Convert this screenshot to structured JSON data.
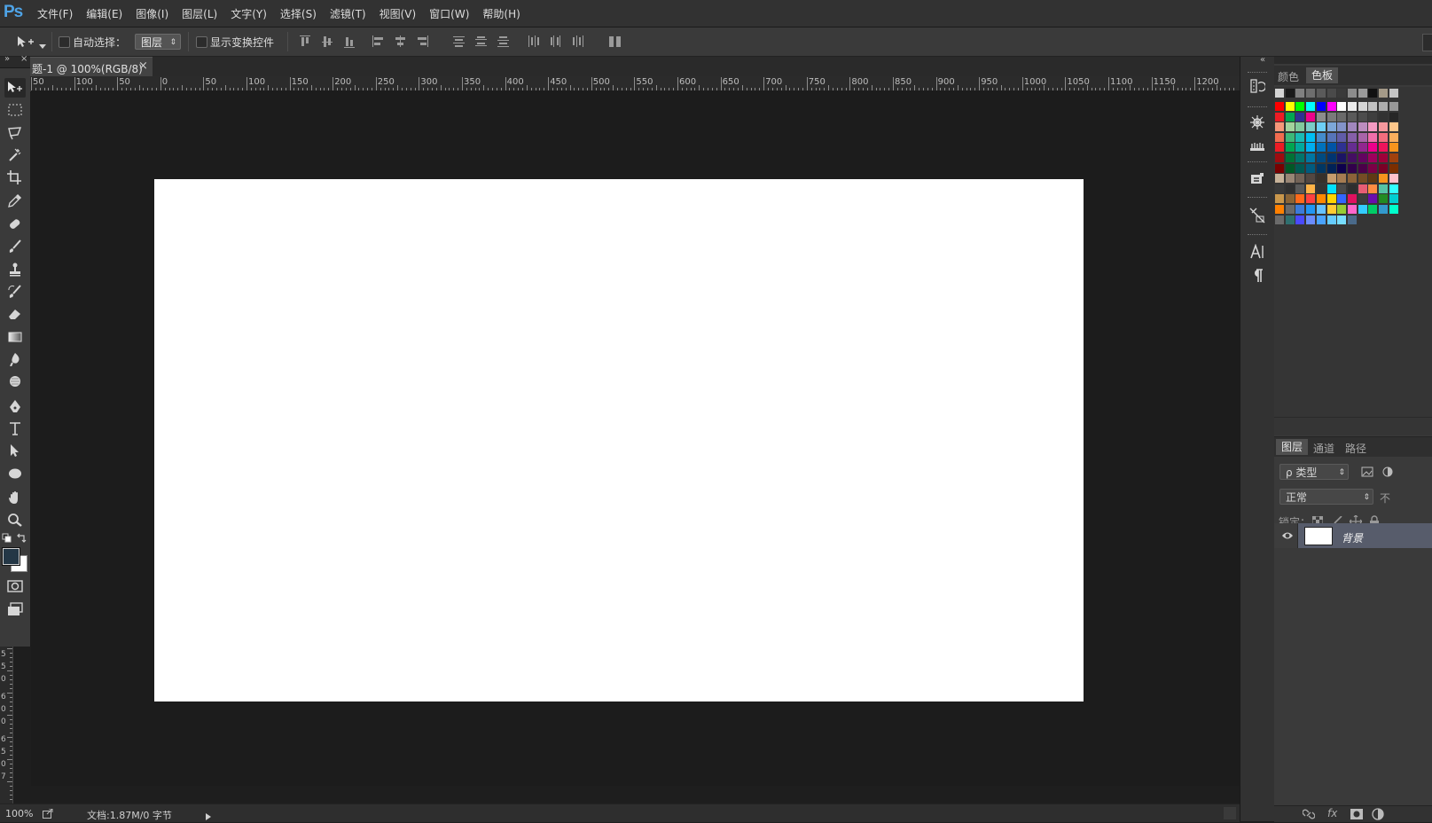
{
  "app": {
    "logo": "Ps"
  },
  "menu": [
    "文件(F)",
    "编辑(E)",
    "图像(I)",
    "图层(L)",
    "文字(Y)",
    "选择(S)",
    "滤镜(T)",
    "视图(V)",
    "窗口(W)",
    "帮助(H)"
  ],
  "options": {
    "auto_select_label": "自动选择：",
    "auto_select_value": "图层",
    "show_transform_label": "显示变换控件"
  },
  "document_tab": {
    "title": "题-1 @ 100%(RGB/8)",
    "close": "×"
  },
  "ruler": {
    "h_labels": [
      "50",
      "100",
      "50",
      "0",
      "50",
      "100",
      "150",
      "200",
      "250",
      "300",
      "350",
      "400",
      "450",
      "500",
      "550",
      "600",
      "650",
      "700",
      "750",
      "800",
      "850",
      "900",
      "950",
      "1000",
      "1050",
      "1100",
      "1150",
      "1200"
    ],
    "v_labels": [
      "5",
      "5",
      "0",
      "6",
      "0",
      "0",
      "6",
      "5",
      "0",
      "7"
    ]
  },
  "right_panel": {
    "top_tabs": [
      "颜色",
      "色板"
    ],
    "active_top_tab": "色板",
    "layer_tabs": [
      "图层",
      "通道",
      "路径"
    ],
    "kind_filter": "ρ 类型",
    "blend_mode": "正常",
    "opacity_label": "不",
    "lock_label": "锁定：",
    "layer_name": "背景"
  },
  "status": {
    "zoom": "100%",
    "doc_info": "文档:1.87M/0 字节"
  },
  "colors": {
    "menubar_bg": "#323232",
    "panel_bg": "#3a3a3a",
    "workspace_bg": "#1c1c1c",
    "canvas": "#ffffff",
    "selected_layer": "#575c6b"
  },
  "swatch_rows": [
    [
      "#d4d4d4",
      "#1a1a1a",
      "#808080",
      "#6e6e6e",
      "#5a5a5a",
      "#4a4a4a",
      "#3a3a3a",
      "#8c8c8c",
      "#9a9a9a",
      "#111111",
      "#a49a88",
      "#c4c4c4"
    ],
    [
      "#ff0000",
      "#ffff00",
      "#00ff00",
      "#00ffff",
      "#0000ff",
      "#ff00ff",
      "#ffffff",
      "#ebebeb",
      "#d6d6d6",
      "#c2c2c2",
      "#adadad",
      "#999999"
    ],
    [
      "#ed1c24",
      "#00a651",
      "#2e3192",
      "#ec008c",
      "#8c8c8c",
      "#7a7a7a",
      "#6a6a6a",
      "#5a5a5a",
      "#4c4c4c",
      "#3e3e3e",
      "#323232",
      "#262626"
    ],
    [
      "#f7977a",
      "#a3d39c",
      "#82ca9c",
      "#7accc8",
      "#6dcff6",
      "#7da7d9",
      "#8393ca",
      "#a187be",
      "#bc8dbf",
      "#f49ac2",
      "#f6989d",
      "#fdc68a"
    ],
    [
      "#f26c4f",
      "#3cb878",
      "#1abbb4",
      "#00bff3",
      "#448ccb",
      "#5674b9",
      "#605ca8",
      "#855fa8",
      "#a864a8",
      "#f06eaa",
      "#f26d7d",
      "#fbaf5d"
    ],
    [
      "#ed1c24",
      "#00a651",
      "#00a99d",
      "#00aeef",
      "#0072bc",
      "#0054a6",
      "#2e3192",
      "#662d91",
      "#92278f",
      "#ec008c",
      "#ed145b",
      "#f7941d"
    ],
    [
      "#9e0b0f",
      "#007236",
      "#00746b",
      "#0076a3",
      "#004a80",
      "#003471",
      "#1b1464",
      "#440e62",
      "#630460",
      "#9e005d",
      "#9e0039",
      "#a0410d"
    ],
    [
      "#790000",
      "#005826",
      "#005952",
      "#005b7f",
      "#003663",
      "#002157",
      "#0d004c",
      "#32004b",
      "#4b0049",
      "#7b0046",
      "#7a0026",
      "#7b2e00"
    ],
    [
      "#c7b299",
      "#998675",
      "#736357",
      "#534741",
      "#37302a",
      "#c69c6d",
      "#a67c52",
      "#8c6239",
      "#754c24",
      "#603913",
      "#f7941d",
      "#ffc0cb"
    ],
    [
      "#3a3a3a",
      "#303030",
      "#5a5a5a",
      "#ffb347",
      "#333333",
      "#00e0ff",
      "#4a4a4a",
      "#2e2e2e",
      "#e85d75",
      "#ff8c42",
      "#55c3a5",
      "#33ffff"
    ],
    [
      "#c9974c",
      "#8a6436",
      "#ff6a1a",
      "#ff4040",
      "#ff8800",
      "#ffd500",
      "#3366ff",
      "#e0115f",
      "#3c3c3c",
      "#6a0dad",
      "#228b22",
      "#00ced1"
    ],
    [
      "#ff8000",
      "#6a6a6a",
      "#3c7bd9",
      "#2196f3",
      "#66c2ff",
      "#ffcc33",
      "#99cc33",
      "#ff66cc",
      "#33ccff",
      "#00cc66",
      "#3399cc",
      "#00ffcc"
    ],
    [
      "#6b6b6b",
      "#2f6f6f",
      "#4a4aff",
      "#6a8cff",
      "#4aa3ff",
      "#66ccff",
      "#77ddff",
      "#4a6a8a"
    ]
  ]
}
